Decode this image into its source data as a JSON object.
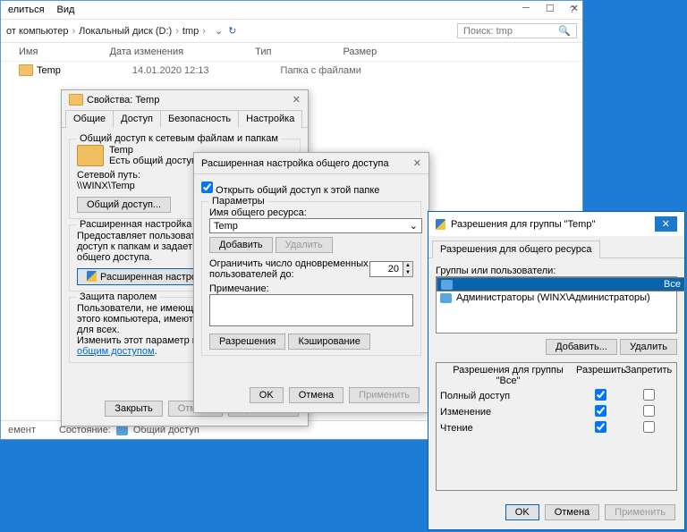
{
  "explorer": {
    "menu": [
      "елиться",
      "Вид"
    ],
    "breadcrumbs": [
      "от компьютер",
      "Локальный диск (D:)",
      "tmp"
    ],
    "search_placeholder": "Поиск: tmp",
    "columns": [
      "Имя",
      "Дата изменения",
      "Тип",
      "Размер"
    ],
    "row": {
      "name": "Temp",
      "date": "14.01.2020 12:13",
      "type": "Папка с файлами"
    },
    "status_label": "Состояние:",
    "status_value": "Общий доступ",
    "left_label": "емент"
  },
  "props": {
    "title": "Свойства: Temp",
    "tabs": [
      "Общие",
      "Доступ",
      "Безопасность",
      "Настройка"
    ],
    "g1_legend": "Общий доступ к сетевым файлам и папкам",
    "folder_name": "Temp",
    "share_state": "Есть общий доступ",
    "netpath_label": "Сетевой путь:",
    "netpath": "\\\\WINX\\Temp",
    "share_btn": "Общий доступ...",
    "g2_legend": "Расширенная настройка общего",
    "g2_text": "Предоставляет пользовательск\nдоступ к папкам и задает другие\nобщего доступа.",
    "adv_btn": "Расширенная настройка...",
    "g3_legend": "Защита паролем",
    "g3_text": "Пользователи, не имеющие учетн\nэтого компьютера, имеют доступ\nдля всех.",
    "g3_text2": "Изменить этот параметр можно",
    "g3_link": "сетями и общим доступом",
    "close": "Закрыть",
    "cancel": "Отмена",
    "apply": "Применить"
  },
  "adv": {
    "title": "Расширенная настройка общего доступа",
    "open_chk": "Открыть общий доступ к этой папке",
    "params": "Параметры",
    "resname_label": "Имя общего ресурса:",
    "resname": "Temp",
    "add": "Добавить",
    "del": "Удалить",
    "limit_label": "Ограничить число одновременных\nпользователей до:",
    "limit_val": "20",
    "note_label": "Примечание:",
    "perm_btn": "Разрешения",
    "cache_btn": "Кэширование",
    "ok": "OK",
    "cancel": "Отмена",
    "apply": "Применить"
  },
  "perm": {
    "title": "Разрешения для группы \"Temp\"",
    "tab": "Разрешения для общего ресурса",
    "groups_label": "Группы или пользователи:",
    "users": [
      "Все",
      "Администраторы (WINX\\Администраторы)"
    ],
    "add": "Добавить...",
    "del": "Удалить",
    "perms_for": "Разрешения для группы \"Все\"",
    "allow": "Разрешить",
    "deny": "Запретить",
    "rows": [
      {
        "name": "Полный доступ",
        "allow": true,
        "deny": false
      },
      {
        "name": "Изменение",
        "allow": true,
        "deny": false
      },
      {
        "name": "Чтение",
        "allow": true,
        "deny": false
      }
    ],
    "ok": "OK",
    "cancel": "Отмена",
    "apply": "Применить"
  }
}
